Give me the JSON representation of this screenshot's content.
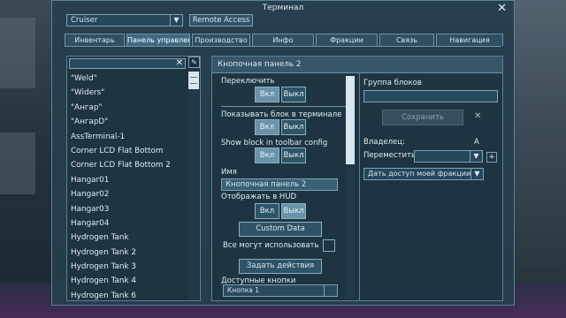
{
  "window": {
    "title": "Терминал"
  },
  "header": {
    "grid_select": "Cruiser",
    "remote_access": "Remote Access"
  },
  "tabs": [
    {
      "label": "Инвентарь"
    },
    {
      "label": "Панель управления"
    },
    {
      "label": "Производство"
    },
    {
      "label": "Инфо"
    },
    {
      "label": "Фракции"
    },
    {
      "label": "Связь"
    },
    {
      "label": "Навигация"
    }
  ],
  "block_list": {
    "search_value": "",
    "items": [
      "\"Weld\"",
      "\"Widers\"",
      "\"Ангар\"",
      "\"АнгарD\"",
      "AssTerminal-1",
      "Corner LCD Flat Bottom",
      "Corner LCD Flat Bottom 2",
      "Hangar01",
      "Hangar02",
      "Hangar03",
      "Hangar04",
      "Hydrogen Tank",
      "Hydrogen Tank 2",
      "Hydrogen Tank 3",
      "Hydrogen Tank 4",
      "Hydrogen Tank 6"
    ]
  },
  "block_panel": {
    "title": "Кнопочная панель 2",
    "toggle_label": "Переключить",
    "show_in_terminal_label": "Показывать блок в терминале",
    "show_in_toolbar_label": "Show block in toolbar config",
    "on_label": "Вкл",
    "off_label": "Выкл",
    "name_label": "Имя",
    "name_value": "Кнопочная панель 2",
    "show_hud_label": "Отображать в HUD",
    "custom_data_label": "Custom Data",
    "anyone_can_use_label": "Все могут использовать",
    "set_actions_label": "Задать действия",
    "available_buttons_label": "Доступные кнопки",
    "button_slot_value": "Кнопка 1"
  },
  "right": {
    "group_label": "Группа блоков",
    "group_value": "",
    "save_label": "Сохранить",
    "owner_label": "Владелец:",
    "owner_value": "A",
    "transfer_label": "Переместить в:",
    "transfer_value": "",
    "share_value": "Дать доступ моей фракции"
  },
  "colors": {
    "panel_bg": "#263e4e",
    "border": "#5d8196",
    "accent": "#6a93aa"
  }
}
